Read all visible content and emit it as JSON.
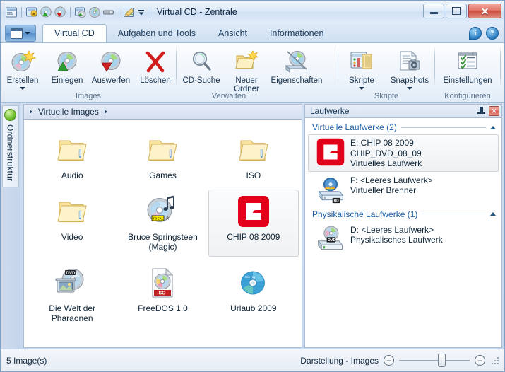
{
  "window": {
    "title": "Virtual CD - Zentrale",
    "minimize_label": "Minimieren",
    "maximize_label": "Maximieren",
    "close_label": "Schließen"
  },
  "quick_access": [
    {
      "name": "app-icon"
    },
    {
      "name": "create-secure-image-icon"
    },
    {
      "name": "insert-image-icon"
    },
    {
      "name": "eject-image-icon"
    },
    {
      "name": "copy-image-icon"
    },
    {
      "name": "cd-icon"
    },
    {
      "name": "usb-icon"
    },
    {
      "name": "edit-image-icon"
    },
    {
      "name": "customize-qat-icon"
    }
  ],
  "tabs": [
    {
      "label": "Virtual CD",
      "active": true
    },
    {
      "label": "Aufgaben und Tools",
      "active": false
    },
    {
      "label": "Ansicht",
      "active": false
    },
    {
      "label": "Informationen",
      "active": false
    }
  ],
  "help_icons": [
    {
      "name": "info-icon",
      "glyph": "i"
    },
    {
      "name": "help-icon",
      "glyph": "?"
    }
  ],
  "ribbon": {
    "groups": [
      {
        "label": "Images",
        "buttons": [
          {
            "label": "Erstellen",
            "icon": "create-cd-icon",
            "has_dropdown": true
          },
          {
            "label": "Einlegen",
            "icon": "insert-cd-icon",
            "has_dropdown": false
          },
          {
            "label": "Auswerfen",
            "icon": "eject-cd-icon",
            "has_dropdown": false
          },
          {
            "label": "Löschen",
            "icon": "delete-red-x-icon",
            "has_dropdown": false
          }
        ]
      },
      {
        "label": "Verwalten",
        "buttons": [
          {
            "label": "CD-Suche",
            "icon": "search-magnifier-icon",
            "has_dropdown": false
          },
          {
            "label": "Neuer Ordner",
            "icon": "new-folder-icon",
            "has_dropdown": false
          },
          {
            "label": "Eigenschaften",
            "icon": "properties-disc-icon",
            "has_dropdown": false
          }
        ]
      },
      {
        "label": "Skripte",
        "buttons": [
          {
            "label": "Skripte",
            "icon": "scripts-icon",
            "has_dropdown": true
          },
          {
            "label": "Snapshots",
            "icon": "snapshots-icon",
            "has_dropdown": true
          }
        ]
      },
      {
        "label": "Konfigurieren",
        "buttons": [
          {
            "label": "Einstellungen",
            "icon": "settings-checklist-icon",
            "has_dropdown": false
          }
        ]
      }
    ]
  },
  "left_dock": {
    "label": "Ordnerstruktur",
    "orb_icon": "green-orb-icon"
  },
  "breadcrumb": {
    "path": "Virtuelle Images"
  },
  "files": [
    {
      "caption": "Audio",
      "icon": "folder-icon"
    },
    {
      "caption": "Games",
      "icon": "folder-icon"
    },
    {
      "caption": "ISO",
      "icon": "folder-icon"
    },
    {
      "caption": "Video",
      "icon": "folder-icon"
    },
    {
      "caption": "Bruce Springsteen (Magic)",
      "icon": "audio-cd-icon"
    },
    {
      "caption": "CHIP 08 2009",
      "icon": "chip-logo-icon",
      "selected": true
    },
    {
      "caption": "Die Welt der Pharaonen",
      "icon": "dvd-video-icon"
    },
    {
      "caption": "FreeDOS 1.0",
      "icon": "iso-file-icon"
    },
    {
      "caption": "Urlaub 2009",
      "icon": "bluray-disc-icon"
    }
  ],
  "drives_panel": {
    "title": "Laufwerke",
    "pin_icon": "pin-icon",
    "close_icon": "close-icon",
    "groups": [
      {
        "title": "Virtuelle Laufwerke (2)",
        "collapse_icon": "chevron-up-icon",
        "drives": [
          {
            "icon": "chip-logo-icon",
            "lines": [
              "E: CHIP 08 2009",
              "CHIP_DVD_08_09",
              "Virtuelles Laufwerk"
            ],
            "selected": true
          },
          {
            "icon": "virtual-burner-icon",
            "lines": [
              "F: <Leeres Laufwerk>",
              "Virtueller Brenner"
            ],
            "selected": false
          }
        ]
      },
      {
        "title": "Physikalische Laufwerke (1)",
        "collapse_icon": "chevron-up-icon",
        "drives": [
          {
            "icon": "physical-dvd-drive-icon",
            "lines": [
              "D: <Leeres Laufwerk>",
              "Physikalisches Laufwerk"
            ],
            "selected": false
          }
        ]
      }
    ]
  },
  "statusbar": {
    "count_text": "5 Image(s)",
    "zoom_label": "Darstellung - Images",
    "zoom_out_glyph": "−",
    "zoom_in_glyph": "+",
    "slider_position_percent": 55
  },
  "colors": {
    "chip_red": "#e2001a",
    "accent_blue": "#1c5fa8",
    "frame_blue": "#7ba2cc"
  }
}
